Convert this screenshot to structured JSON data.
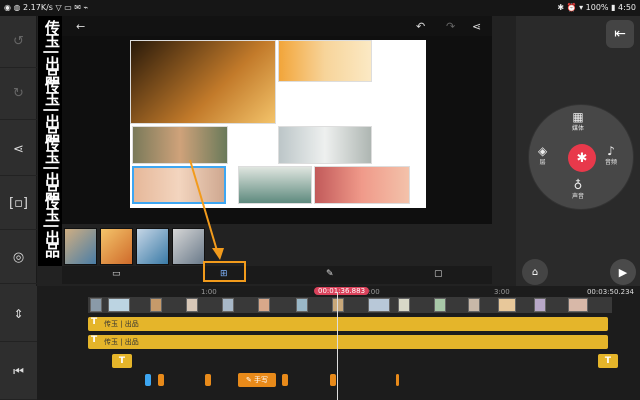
{
  "status": {
    "net_speed": "2.17K/s",
    "battery": "100%",
    "time": "4:50"
  },
  "watermark": {
    "text": "传玉 | 出品"
  },
  "mode_tabs": [
    "media-tab",
    "layout-tab",
    "draw-tab",
    "crop-tab"
  ],
  "radial_menu": {
    "media": "媒体",
    "layer": "层",
    "audio": "音频",
    "voice": "声音"
  },
  "timeline": {
    "ruler": [
      "1:00",
      "2:00",
      "3:00"
    ],
    "current_time": "00:01:36.883",
    "end_time": "00:03:50.234",
    "text_layers": [
      {
        "label": "传玉 | 出品"
      },
      {
        "label": "传玉 | 出品"
      }
    ],
    "handwriting_label": "手写",
    "text_badge": "T"
  },
  "colors": {
    "accent_orange": "#f29b1c",
    "text_track": "#e5b52a",
    "record": "#e8394b",
    "time_badge": "#d9425b"
  }
}
